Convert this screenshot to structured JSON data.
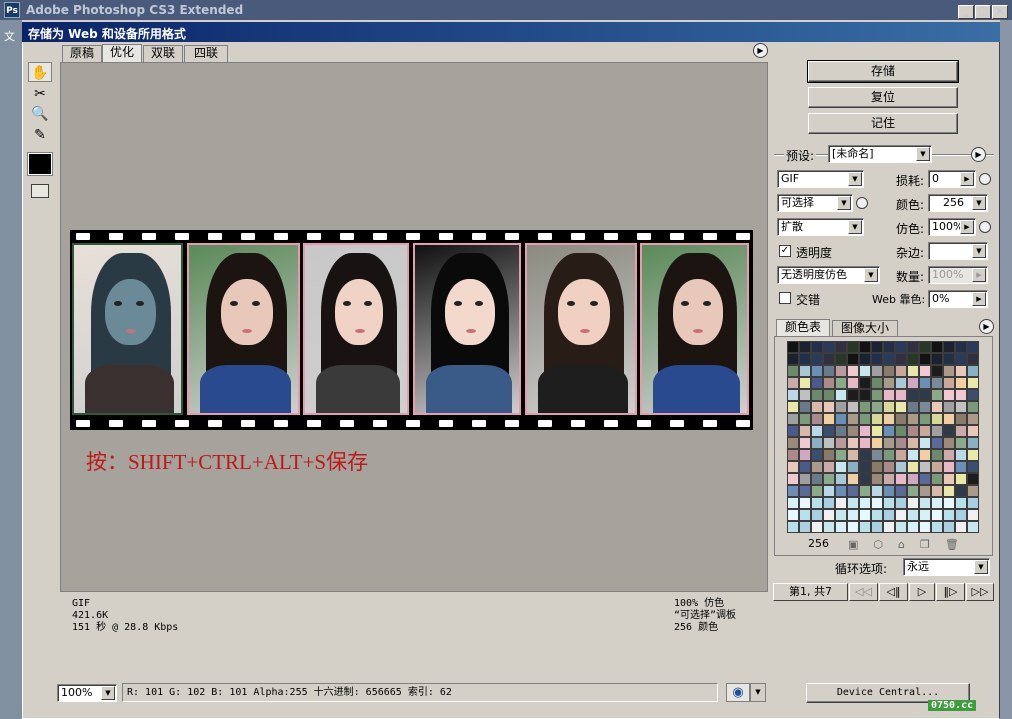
{
  "app": {
    "title": "Adobe Photoshop CS3 Extended",
    "logo": "Ps",
    "menu_first": "文"
  },
  "dialog": {
    "title": "存储为 Web 和设备所用格式"
  },
  "tabs": [
    "原稿",
    "优化",
    "双联",
    "四联"
  ],
  "active_tab": 1,
  "image_overlay_text": "按：SHIFT+CTRL+ALT+S保存",
  "info_left": {
    "format": "GIF",
    "size": "421.6K",
    "time": "151 秒 @ 28.8 Kbps"
  },
  "info_right": {
    "dither": "100% 仿色",
    "palette": "“可选择”调板",
    "colors": "256 颜色"
  },
  "buttons": {
    "save": "存储",
    "reset": "复位",
    "remember": "记住"
  },
  "preset": {
    "label": "预设:",
    "value": "[未命名]"
  },
  "settings": {
    "format": "GIF",
    "lossy_label": "损耗:",
    "lossy": "0",
    "reduction": "可选择",
    "colors_label": "颜色:",
    "colors": "256",
    "dither_algo": "扩散",
    "dither_label": "仿色:",
    "dither": "100%",
    "transparency_label": "透明度",
    "transparency_checked": true,
    "matte_label": "杂边:",
    "matte": "",
    "trans_dither": "无透明度仿色",
    "amount_label": "数量:",
    "amount": "100%",
    "interlace_label": "交错",
    "interlace_checked": false,
    "websnap_label": "Web 靠色:",
    "websnap": "0%"
  },
  "panel_tabs": [
    "颜色表",
    "图像大小"
  ],
  "color_count": "256",
  "loop": {
    "label": "循环选项:",
    "value": "永远"
  },
  "animation": {
    "frame_label": "第1, 共7",
    "btns": [
      "◁◁",
      "◁‖",
      "▷",
      "‖▷",
      "▷▷"
    ]
  },
  "status": {
    "zoom": "100%",
    "readout": "R: 101  G: 102  B: 101  Alpha:255  十六进制: 656665  索引:  62",
    "device_central": "Device Central..."
  },
  "watermark": "0750.cc",
  "colors": {
    "accent": "#0a246a",
    "hint": "#c01818",
    "frame_border": "#e89ab0"
  }
}
